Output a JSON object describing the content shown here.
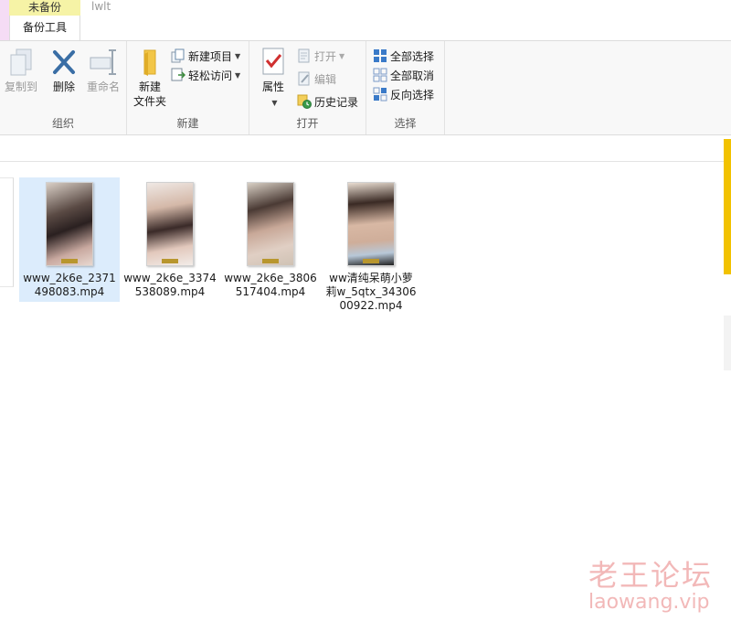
{
  "tabs": {
    "context_group": "未备份",
    "context_tab": "备份工具",
    "window_title": "lwlt"
  },
  "ribbon": {
    "organize": {
      "label": "组织",
      "copy_to": "复制到",
      "delete": "删除",
      "rename": "重命名"
    },
    "new": {
      "label": "新建",
      "new_folder_line1": "新建",
      "new_folder_line2": "文件夹",
      "new_item": "新建项目",
      "easy_access": "轻松访问"
    },
    "open": {
      "label": "打开",
      "properties": "属性",
      "open": "打开",
      "edit": "编辑",
      "history": "历史记录"
    },
    "select": {
      "label": "选择",
      "select_all": "全部选择",
      "select_none": "全部取消",
      "invert": "反向选择"
    }
  },
  "files": [
    {
      "name": "www_2k6e_2371498083.mp4",
      "selected": true
    },
    {
      "name": "www_2k6e_3374538089.mp4",
      "selected": false
    },
    {
      "name": "www_2k6e_3806517404.mp4",
      "selected": false
    },
    {
      "name": "ww清纯呆萌小萝莉w_5qtx_3430600922.mp4",
      "selected": false
    }
  ],
  "watermark": {
    "cn": "老王论坛",
    "en": "laowang.vip"
  },
  "colors": {
    "context_tab": "#f6f3a6",
    "selection": "#dcecfc",
    "delete_icon": "#3a6ea5",
    "watermark": "#f2b8b8"
  }
}
